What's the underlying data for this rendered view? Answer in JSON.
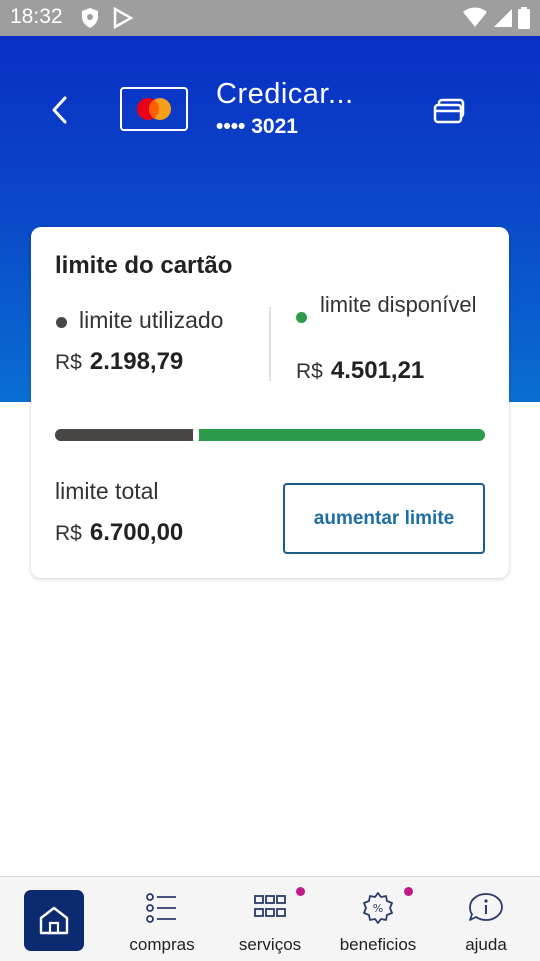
{
  "status_bar": {
    "time": "18:32",
    "left_icons": [
      "shield-icon",
      "play-protect-icon"
    ],
    "right_icons": [
      "wifi-icon",
      "signal-icon",
      "battery-icon"
    ]
  },
  "header": {
    "back_icon": "chevron-left-icon",
    "card_brand_icon": "mastercard-logo",
    "card_name": "Credicar...",
    "card_number": "•••• 3021",
    "cards_icon": "cards-stack-icon",
    "bg_color_top": "#0a2fc4",
    "bg_color_bottom": "#0a6fd2"
  },
  "limit_card": {
    "title": "limite do cartão",
    "used": {
      "label": "limite utilizado",
      "currency": "R$",
      "amount": "2.198,79",
      "dot_color": "#4a4645"
    },
    "available": {
      "label": "limite disponível",
      "currency": "R$",
      "amount": "4.501,21",
      "dot_color": "#2e9a4b"
    },
    "usage_fraction": 0.328,
    "total": {
      "label": "limite total",
      "currency": "R$",
      "amount": "6.700,00"
    },
    "increase_button": "aumentar limite"
  },
  "bottom_nav": {
    "items": [
      {
        "label": "",
        "icon": "home-icon",
        "active": true
      },
      {
        "label": "compras",
        "icon": "list-icon",
        "badge": false
      },
      {
        "label": "serviços",
        "icon": "grid-icon",
        "badge": true
      },
      {
        "label": "beneficios",
        "icon": "gear-badge-icon",
        "badge": true
      },
      {
        "label": "ajuda",
        "icon": "info-chat-icon",
        "badge": false
      }
    ],
    "active_color": "#0b2a6f",
    "badge_color": "#c2188b"
  }
}
